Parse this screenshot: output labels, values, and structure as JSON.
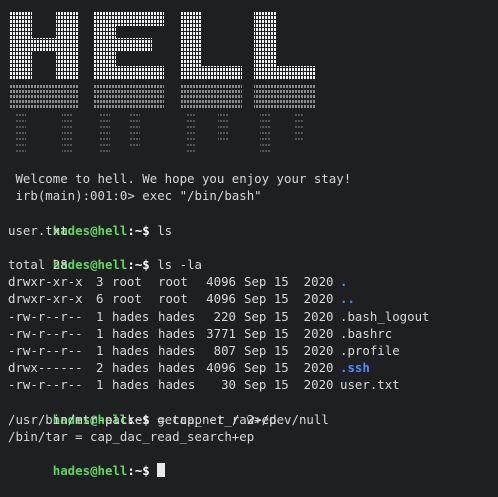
{
  "banner": {
    "art_text": "HELL"
  },
  "prompt": {
    "user_host": "hades@hell",
    "path": ":~$"
  },
  "welcome": " Welcome to hell. We hope you enjoy your stay!",
  "irb": " irb(main):001:0> exec \"/bin/bash\"",
  "commands": {
    "ls": " ls",
    "ls_la": " ls -la",
    "getcap": " getcap -r / 2>/dev/null",
    "final": " "
  },
  "ls_output": "user.txt",
  "total": "total 28",
  "listing": [
    {
      "perm": "drwxr-xr-x",
      "links": "3",
      "owner": "root",
      "group": "root",
      "size": "4096",
      "date": "Sep 15  2020",
      "name": ".",
      "is_dir": true
    },
    {
      "perm": "drwxr-xr-x",
      "links": "6",
      "owner": "root",
      "group": "root",
      "size": "4096",
      "date": "Sep 15  2020",
      "name": "..",
      "is_dir": true
    },
    {
      "perm": "-rw-r--r--",
      "links": "1",
      "owner": "hades",
      "group": "hades",
      "size": "220",
      "date": "Sep 15  2020",
      "name": ".bash_logout",
      "is_dir": false
    },
    {
      "perm": "-rw-r--r--",
      "links": "1",
      "owner": "hades",
      "group": "hades",
      "size": "3771",
      "date": "Sep 15  2020",
      "name": ".bashrc",
      "is_dir": false
    },
    {
      "perm": "-rw-r--r--",
      "links": "1",
      "owner": "hades",
      "group": "hades",
      "size": "807",
      "date": "Sep 15  2020",
      "name": ".profile",
      "is_dir": false
    },
    {
      "perm": "drwx------",
      "links": "2",
      "owner": "hades",
      "group": "hades",
      "size": "4096",
      "date": "Sep 15  2020",
      "name": ".ssh",
      "is_dir": true
    },
    {
      "perm": "-rw-r--r--",
      "links": "1",
      "owner": "hades",
      "group": "hades",
      "size": "30",
      "date": "Sep 15  2020",
      "name": "user.txt",
      "is_dir": false
    }
  ],
  "getcap_output": [
    "/usr/bin/mtr-packet = cap_net_raw+ep",
    "/bin/tar = cap_dac_read_search+ep"
  ],
  "colors": {
    "background": "#1d1f21",
    "prompt_user": "#5fd75f",
    "directory": "#4f8cff",
    "text": "#d8d8d8"
  }
}
